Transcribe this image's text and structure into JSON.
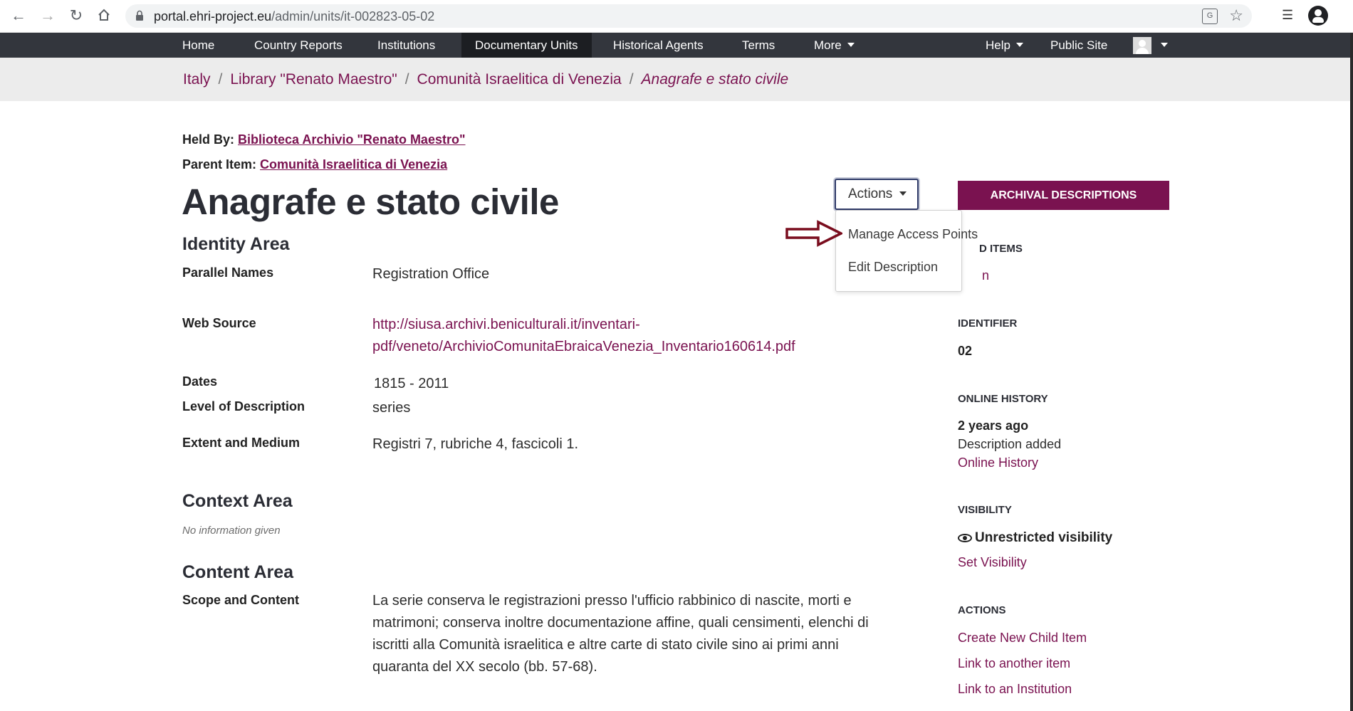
{
  "browser": {
    "url_host": "portal.ehri-project.eu",
    "url_path": "/admin/units/it-002823-05-02"
  },
  "nav": {
    "home": "Home",
    "country_reports": "Country Reports",
    "institutions": "Institutions",
    "documentary_units": "Documentary Units",
    "historical_agents": "Historical Agents",
    "terms": "Terms",
    "more": "More",
    "help": "Help",
    "public_site": "Public Site"
  },
  "breadcrumb": {
    "items": [
      "Italy",
      "Library \"Renato Maestro\"",
      "Comunità Israelitica di Venezia"
    ],
    "current": "Anagrafe e stato civile",
    "separator": "/"
  },
  "meta": {
    "held_by_label": "Held By:",
    "held_by_value": "Biblioteca Archivio \"Renato Maestro\"",
    "parent_label": "Parent Item:",
    "parent_value": "Comunità Israelitica di Venezia"
  },
  "title": "Anagrafe e stato civile",
  "actions": {
    "button": "Actions",
    "menu": [
      "Manage Access Points",
      "Edit Description"
    ]
  },
  "identity": {
    "heading": "Identity Area",
    "parallel_names_label": "Parallel Names",
    "parallel_names_value": "Registration Office",
    "web_source_label": "Web Source",
    "web_source_line1": "http://siusa.archivi.beniculturali.it/inventari-",
    "web_source_line2": "pdf/veneto/ArchivioComunitaEbraicaVenezia_Inventario160614.pdf",
    "dates_label": "Dates",
    "dates_value": "1815 - 2011",
    "level_label": "Level of Description",
    "level_value": "series",
    "extent_label": "Extent and Medium",
    "extent_value": "Registri 7, rubriche 4, fascicoli 1."
  },
  "context": {
    "heading": "Context Area",
    "empty": "No information given"
  },
  "content": {
    "heading": "Content Area",
    "scope_label": "Scope and Content",
    "scope_line1": "La serie conserva le registrazioni presso l'ufficio rabbinico di nascite, morti e",
    "scope_line2": "matrimoni; conserva inoltre documentazione affine, quali censimenti, elenchi di",
    "scope_line3": "iscritti alla Comunità israelitica e altre carte di stato civile sino ai primi anni",
    "scope_line4": "quaranta del XX secolo (bb. 57-68)."
  },
  "sidebar": {
    "archival_button": "ARCHIVAL DESCRIPTIONS",
    "child_items_heading_visible": "D ITEMS",
    "child_items_value_visible": "n",
    "identifier_heading": "IDENTIFIER",
    "identifier_value": "02",
    "online_history_heading": "ONLINE HISTORY",
    "history_when": "2 years ago",
    "history_desc": "Description added",
    "history_link": "Online History",
    "visibility_heading": "VISIBILITY",
    "visibility_value": "Unrestricted visibility",
    "set_visibility": "Set Visibility",
    "actions_heading": "ACTIONS",
    "action_links": [
      "Create New Child Item",
      "Link to another item",
      "Link to an Institution"
    ]
  },
  "colors": {
    "brand": "#7a1250",
    "navbar": "#33363d",
    "navbar_active": "#1c1e22",
    "breadcrumb_bg": "#ececec"
  }
}
